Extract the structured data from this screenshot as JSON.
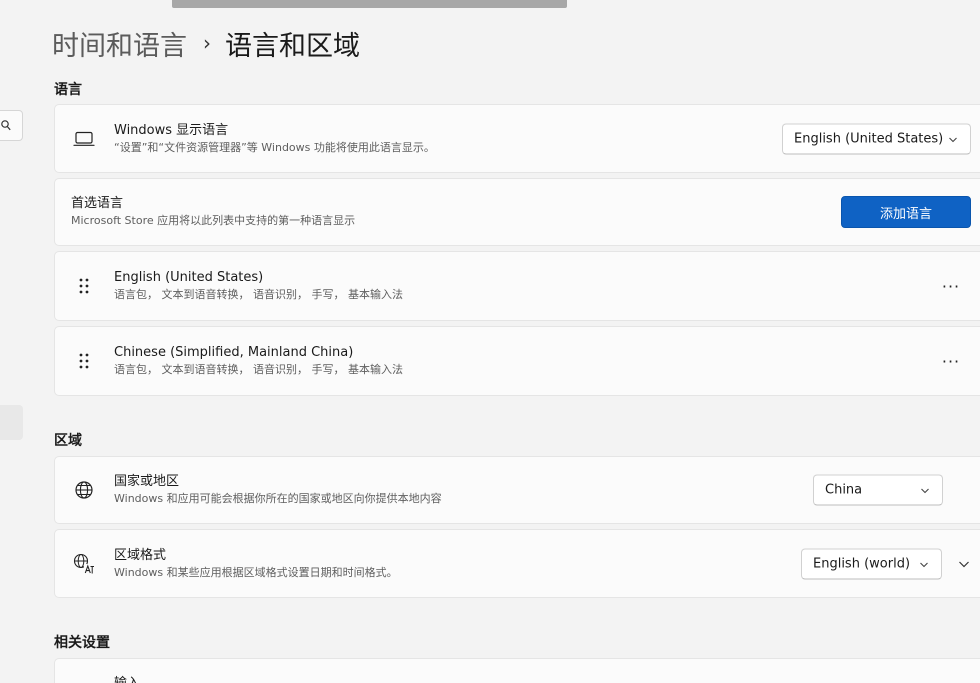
{
  "breadcrumb": {
    "parent": "时间和语言",
    "separator": "›",
    "current": "语言和区域"
  },
  "sections": {
    "language": "语言",
    "region": "区域",
    "related": "相关设置"
  },
  "display_language": {
    "icon": "monitor-icon",
    "title": "Windows 显示语言",
    "description": "“设置”和“文件资源管理器”等 Windows 功能将使用此语言显示。",
    "value": "English (United States)"
  },
  "preferred_languages": {
    "title": "首选语言",
    "description": "Microsoft Store 应用将以此列表中支持的第一种语言显示",
    "button": "添加语言"
  },
  "languages": [
    {
      "name": "English (United States)",
      "features": "语言包， 文本到语音转换， 语音识别， 手写， 基本输入法",
      "more": "···"
    },
    {
      "name": "Chinese (Simplified, Mainland China)",
      "features": "语言包， 文本到语音转换， 语音识别， 手写， 基本输入法",
      "more": "···"
    }
  ],
  "country": {
    "icon": "globe-icon",
    "title": "国家或地区",
    "description": "Windows 和应用可能会根据你所在的国家或地区向你提供本地内容",
    "value": "China"
  },
  "regional_format": {
    "icon": "globe-language-icon",
    "title": "区域格式",
    "description": "Windows 和某些应用根据区域格式设置日期和时间格式。",
    "value": "English (world)"
  },
  "related": {
    "partial_item": "输入"
  },
  "colors": {
    "accent": "#0f62c4",
    "background": "#f3f3f3",
    "card": "#fbfbfb"
  }
}
